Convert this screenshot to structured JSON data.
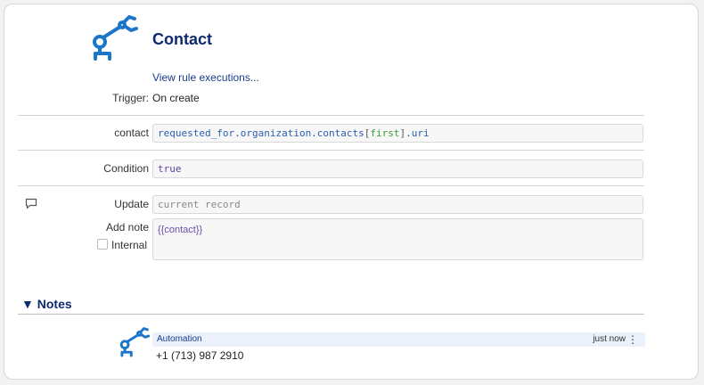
{
  "rule": {
    "title": "Contact",
    "view_executions": "View rule executions...",
    "trigger_label": "Trigger:",
    "trigger_value": "On create"
  },
  "fields": {
    "contact_label": "contact",
    "contact_expr": {
      "p1": "requested_for.organization.contacts",
      "b1": "[",
      "kw": "first",
      "b2": "]",
      "p2": ".uri"
    },
    "condition_label": "Condition",
    "condition_value": "true"
  },
  "action": {
    "update_label": "Update",
    "update_placeholder": "current record",
    "add_note_label": "Add note",
    "note_value": "{{contact}}",
    "internal_label": "Internal",
    "internal_checked": false
  },
  "notes": {
    "header": "▼ Notes",
    "items": [
      {
        "author": "Automation",
        "time": "just now",
        "menu": "⋮",
        "text": "+1 (713) 987 2910"
      }
    ]
  },
  "colors": {
    "accent": "#0d2a70",
    "robot": "#1b75c9",
    "note_bar": "#eaf1fb"
  },
  "icons": {
    "robot": "robot-arm-icon",
    "comment": "comment-icon"
  }
}
